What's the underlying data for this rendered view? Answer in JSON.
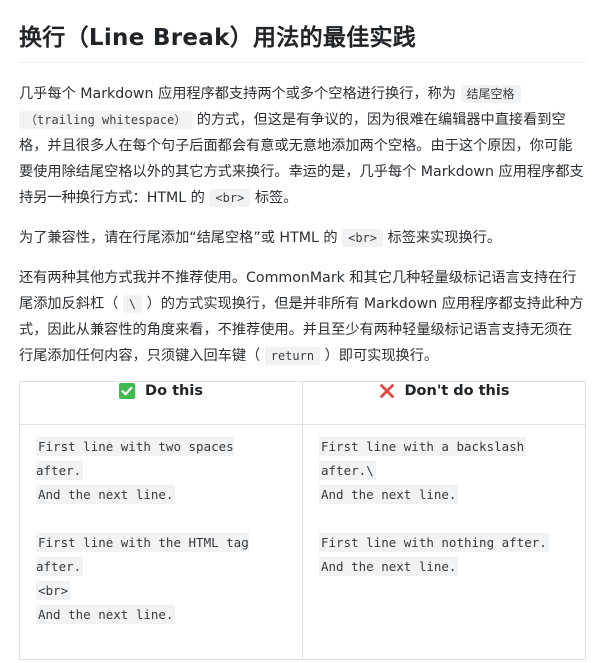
{
  "title": "换行（Line Break）用法的最佳实践",
  "para1": {
    "t1": "几乎每个 Markdown 应用程序都支持两个或多个空格进行换行，称为",
    "code1": "结尾空格",
    "code2": "（trailing whitespace）",
    "t2": "的方式，但这是有争议的，因为很难在编辑器中直接看到空格，并且很多人在每个句子后面都会有意或无意地添加两个空格。由于这个原因，你可能要使用除结尾空格以外的其它方式来换行。幸运的是，几乎每个 Markdown 应用程序都支持另一种换行方式：HTML 的",
    "code3": "<br>",
    "t3": "标签。"
  },
  "para2": {
    "t1": "为了兼容性，请在行尾添加“结尾空格”或 HTML 的",
    "code1": "<br>",
    "t2": "标签来实现换行。"
  },
  "para3": {
    "t1": "还有两种其他方式我并不推荐使用。CommonMark 和其它几种轻量级标记语言支持在行尾添加反斜杠（",
    "code1": "\\",
    "t2": "）的方式实现换行，但是并非所有 Markdown 应用程序都支持此种方式，因此从兼容性的角度来看，不推荐使用。并且至少有两种轻量级标记语言支持无须在行尾添加任何内容，只须键入回车键（",
    "code2": "return",
    "t3": "）即可实现换行。"
  },
  "table": {
    "do_header": "Do this",
    "dont_header": "Don't do this",
    "do_icon": "check-mark-icon",
    "dont_icon": "cross-mark-icon",
    "do_icon_color": "#3fb950",
    "dont_icon_color": "#e5483f",
    "do_lines_a": [
      "First line with two spaces after.",
      "And the next line."
    ],
    "do_lines_b": [
      "First line with the HTML tag after.",
      "<br>",
      "And the next line."
    ],
    "dont_lines_a": [
      "First line with a backslash",
      "after.\\",
      "And the next line."
    ],
    "dont_lines_b": [
      "First line with nothing after.",
      "And the next line."
    ]
  }
}
